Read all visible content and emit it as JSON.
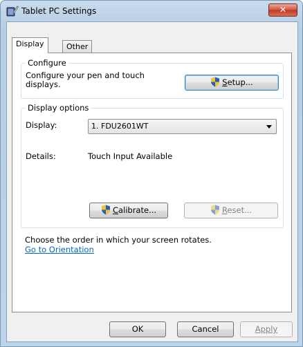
{
  "window": {
    "title": "Tablet PC Settings",
    "close_glyph": "✕"
  },
  "tabs": [
    {
      "label": "Display",
      "selected": true
    },
    {
      "label": "Other",
      "selected": false
    }
  ],
  "configure": {
    "group_title": "Configure",
    "description": "Configure your pen and touch displays.",
    "setup_button": {
      "accel": "S",
      "rest": "etup..."
    }
  },
  "display_options": {
    "group_title": "Display options",
    "display_label": "Display:",
    "display_value": "1. FDU2601WT",
    "details_label": "Details:",
    "details_value": "Touch Input Available",
    "calibrate_button": {
      "accel": "C",
      "rest": "alibrate..."
    },
    "reset_button": {
      "accel": "R",
      "rest": "eset..."
    }
  },
  "orientation": {
    "text": "Choose the order in which your screen rotates.",
    "link": "Go to Orientation"
  },
  "footer": {
    "ok": "OK",
    "cancel": "Cancel",
    "apply": "Apply"
  },
  "icons": {
    "title": "tablet-pen-icon",
    "shield": "uac-shield-icon"
  }
}
